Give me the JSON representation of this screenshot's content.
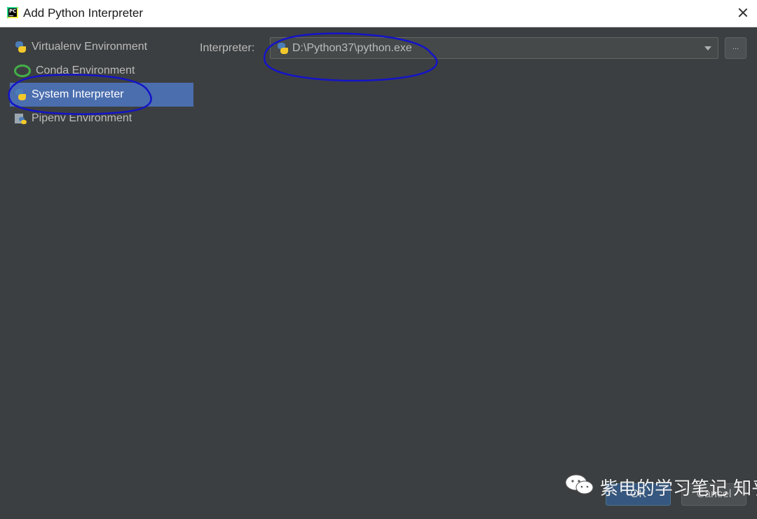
{
  "window": {
    "title": "Add Python Interpreter"
  },
  "sidebar": {
    "items": [
      {
        "label": "Virtualenv Environment",
        "icon": "python-icon",
        "selected": false
      },
      {
        "label": "Conda Environment",
        "icon": "conda-icon",
        "selected": false
      },
      {
        "label": "System Interpreter",
        "icon": "python-icon",
        "selected": true
      },
      {
        "label": "Pipenv Environment",
        "icon": "pipenv-icon",
        "selected": false
      }
    ]
  },
  "main": {
    "interpreter_label": "Interpreter:",
    "interpreter_value": "D:\\Python37\\python.exe",
    "browse_label": "..."
  },
  "footer": {
    "ok_label": "OK",
    "cancel_label": "Cancel"
  },
  "watermark": {
    "text": "紫电的学习笔记 知乎 @紫电"
  },
  "colors": {
    "background": "#3c3f41",
    "selection": "#4b6eaf",
    "annotation_ink": "#1414c8",
    "conda_green": "#43b049"
  }
}
